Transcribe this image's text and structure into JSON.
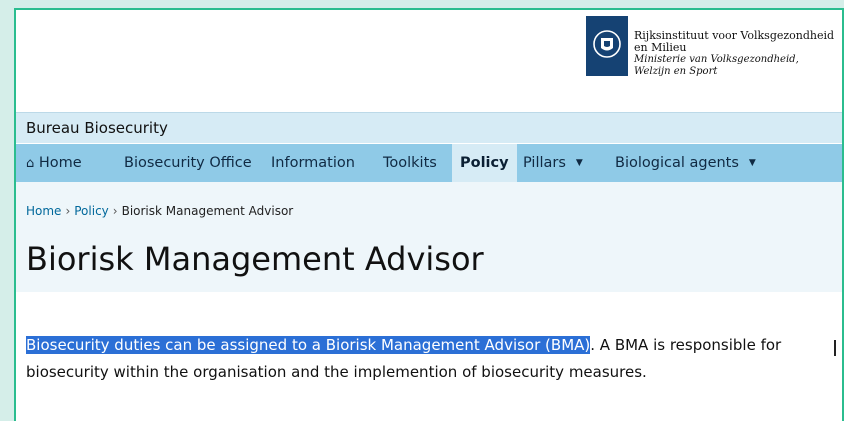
{
  "logo": {
    "line1": "Rijksinstituut voor Volksgezondheid",
    "line2": "en Milieu",
    "line3": "Ministerie van Volksgezondheid,",
    "line4": "Welzijn en Sport"
  },
  "site_name": "Bureau Biosecurity",
  "nav": {
    "home": "Home",
    "items": [
      "Biosecurity Office",
      "Information",
      "Toolkits",
      "Policy",
      "Pillars",
      "Biological agents"
    ]
  },
  "breadcrumb": {
    "home": "Home",
    "policy": "Policy",
    "current": "Biorisk Management Advisor"
  },
  "page_title": "Biorisk Management Advisor",
  "content": {
    "selected": "Biosecurity duties can be assigned to a Biorisk Management Advisor (BMA)",
    "rest": ". A BMA is responsible for biosecurity within the organisation and the implemention of biosecurity measures."
  },
  "colors": {
    "brand": "#154273",
    "nav": "#8fcae7",
    "selection": "#2b6fd6",
    "frame": "#2bbd8f"
  }
}
